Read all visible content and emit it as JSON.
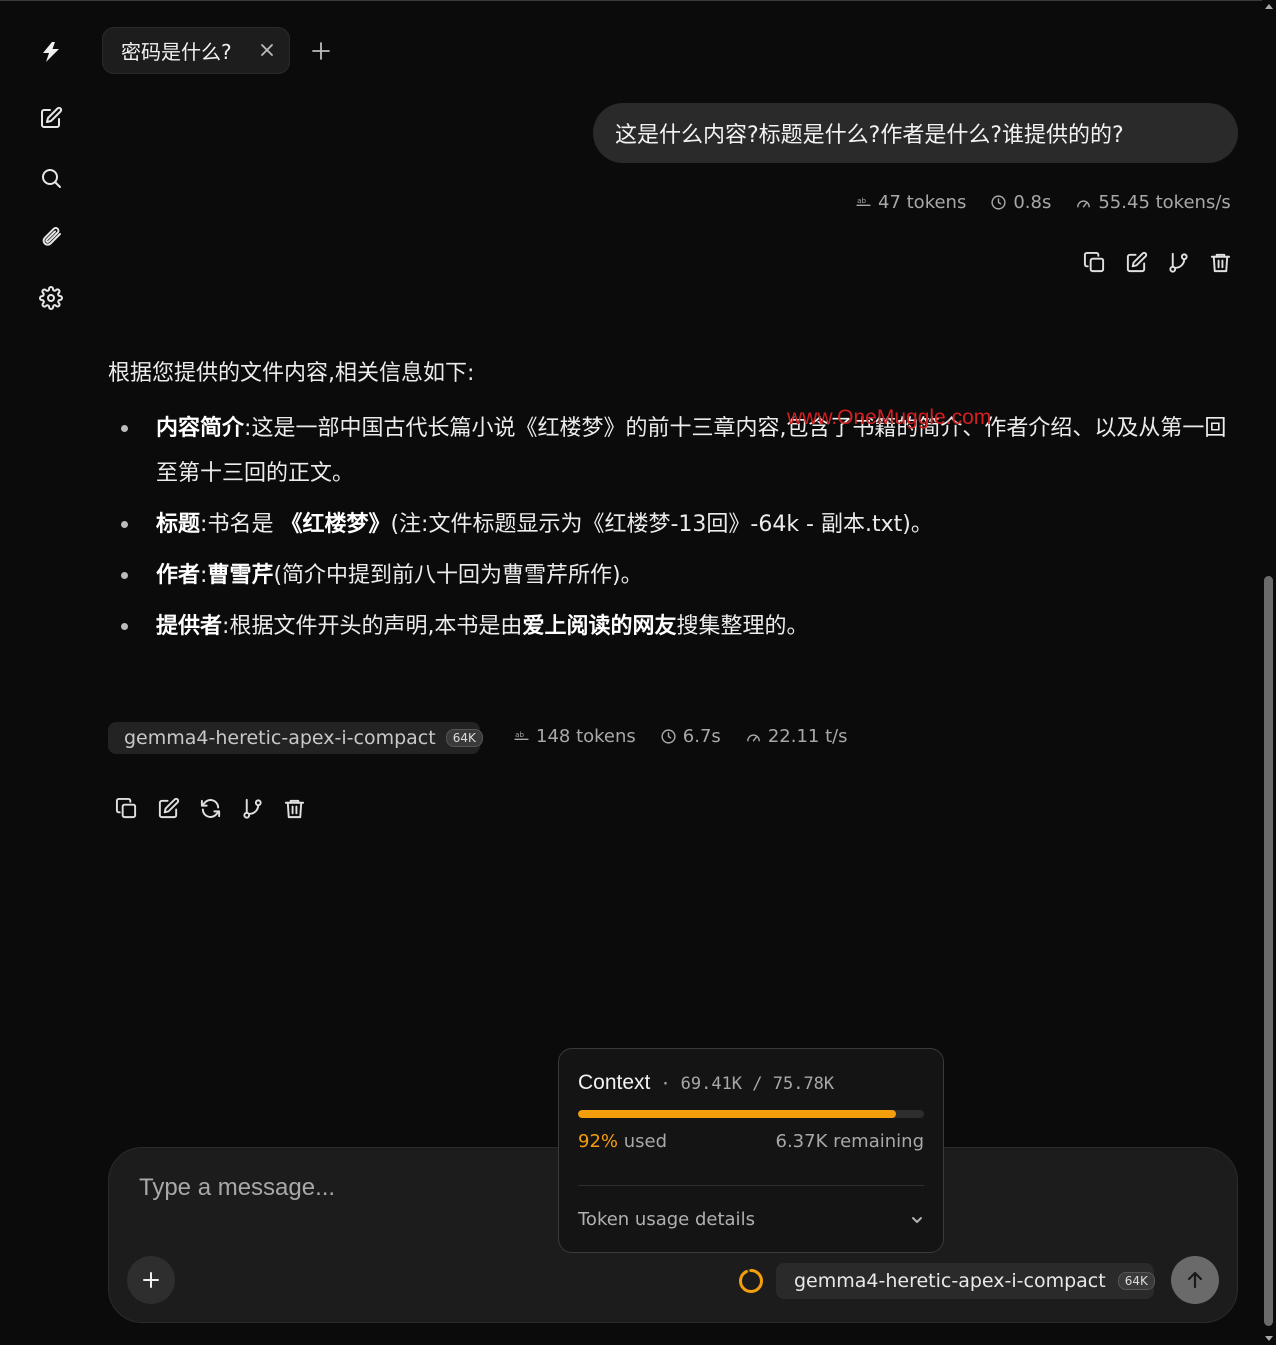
{
  "tab": {
    "label": "密码是什么?"
  },
  "user_message": {
    "text": "这是什么内容?标题是什么?作者是什么?谁提供的的?",
    "stats": {
      "tokens": "47 tokens",
      "time": "0.8s",
      "speed": "55.45 tokens/s"
    }
  },
  "assistant": {
    "intro": "根据您提供的文件内容,相关信息如下:",
    "bullets": [
      {
        "label": "内容简介",
        "sep": ":",
        "text": "这是一部中国古代长篇小说《红楼梦》的前十三章内容,包含了书籍的简介、作者介绍、以及从第一回至第十三回的正文。"
      },
      {
        "label": "标题",
        "sep": ":",
        "pre": "书名是 ",
        "bold": "《红楼梦》",
        "text": "(注:文件标题显示为《红楼梦-13回》-64k - 副本.txt)。"
      },
      {
        "label": "作者",
        "sep": ":",
        "bold": "曹雪芹",
        "text": "(简介中提到前八十回为曹雪芹所作)。"
      },
      {
        "label": "提供者",
        "sep": ":",
        "pre": "根据文件开头的声明,本书是由",
        "bold": "爱上阅读的网友",
        "text": "搜集整理的。"
      }
    ],
    "model": {
      "name": "gemma4-heretic-apex-i-compact",
      "badge": "64K"
    },
    "stats": {
      "tokens": "148 tokens",
      "time": "6.7s",
      "speed": "22.11 t/s"
    }
  },
  "watermark": "www.OneMuggle.com",
  "input": {
    "placeholder": "Type a message..."
  },
  "context_popup": {
    "title": "Context",
    "separator": "·",
    "usage": "69.41K / 75.78K",
    "used_fraction": 0.92,
    "used_pct": "92%",
    "used_label": " used",
    "remaining": "6.37K remaining",
    "details_label": "Token usage details"
  },
  "composer_model": {
    "name": "gemma4-heretic-apex-i-compact",
    "badge": "64K"
  },
  "colors": {
    "accent": "#f59e0b",
    "background": "#0b0b0b",
    "bubble": "#2a2a2a"
  },
  "icons": {
    "sidebar": [
      "lightning-logo-icon",
      "new-chat-icon",
      "search-icon",
      "attachment-icon",
      "settings-icon"
    ],
    "user_actions": [
      "copy-icon",
      "edit-icon",
      "branch-icon",
      "delete-icon"
    ],
    "assistant_actions": [
      "copy-icon",
      "edit-icon",
      "regenerate-icon",
      "branch-icon",
      "delete-icon"
    ]
  }
}
